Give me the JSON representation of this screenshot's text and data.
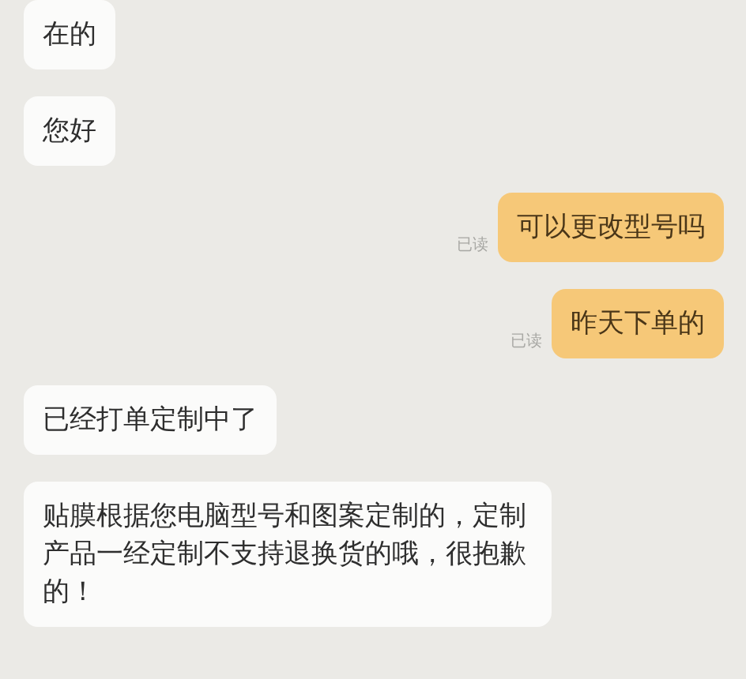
{
  "messages": [
    {
      "kind": "incoming",
      "text": "在的"
    },
    {
      "kind": "incoming",
      "text": "您好"
    },
    {
      "kind": "outgoing",
      "text": "可以更改型号吗",
      "receipt": "已读"
    },
    {
      "kind": "outgoing",
      "text": "昨天下单的",
      "receipt": "已读"
    },
    {
      "kind": "incoming",
      "text": "已经打单定制中了"
    },
    {
      "kind": "incoming",
      "text": "贴膜根据您电脑型号和图案定制的，定制产品一经定制不支持退换货的哦，很抱歉的！"
    }
  ]
}
